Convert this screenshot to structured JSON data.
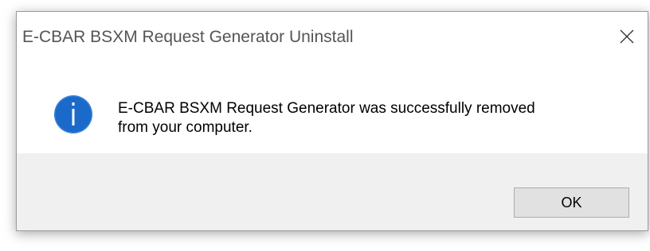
{
  "dialog": {
    "title": "E-CBAR BSXM Request Generator Uninstall",
    "close_icon": "close-icon",
    "info_icon": "information-icon",
    "message_line1": "E-CBAR BSXM Request Generator was successfully removed",
    "message_line2": "from your computer.",
    "ok_label": "OK"
  },
  "colors": {
    "info_icon_blue": "#1b6ac9",
    "footer_bg": "#f0f0f0",
    "button_bg": "#e1e1e1",
    "button_border": "#adadad"
  }
}
